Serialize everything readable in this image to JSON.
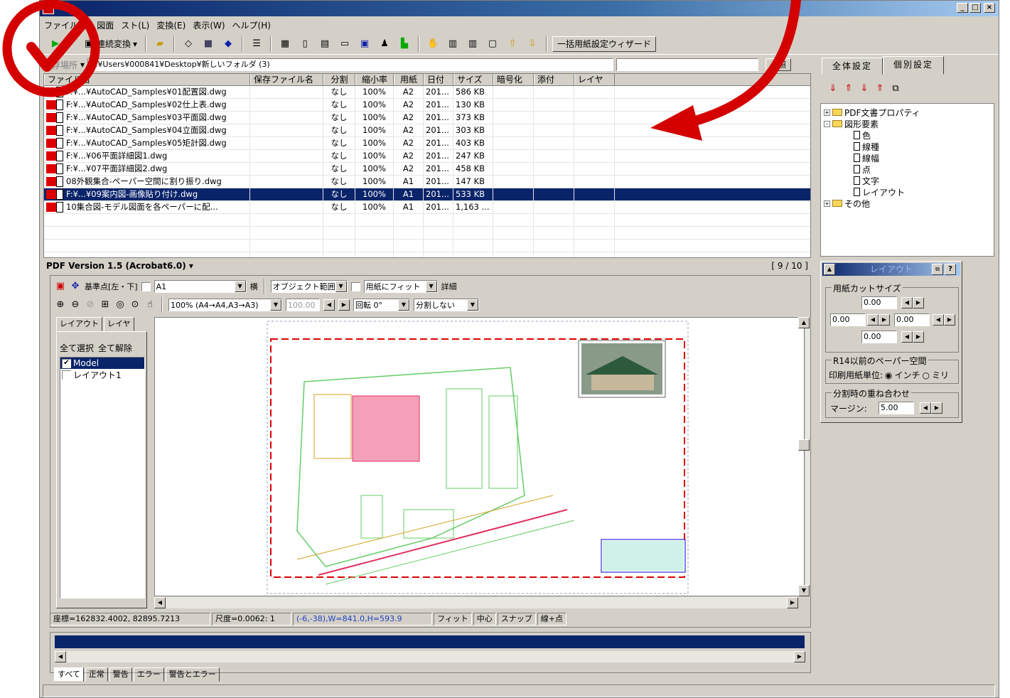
{
  "menu": [
    "ファイル(F)",
    "図面",
    "スト(L)",
    "変換(E)",
    "表示(W)",
    "ヘルプ(H)"
  ],
  "toolbar": {
    "convert_label": "連続変換",
    "wizard_label": "一括用紙設定ウィザード"
  },
  "pathbar": {
    "label": "保存場所",
    "path": "C:¥Users¥000841¥Desktop¥新しいフォルダ (3)",
    "browse": "参照"
  },
  "filelist": {
    "headers": [
      "ファイル名",
      "保存ファイル名",
      "分割",
      "縮小率",
      "用紙",
      "日付",
      "サイズ",
      "暗号化",
      "添付",
      "レイヤ"
    ],
    "rows": [
      {
        "name": "F:¥...¥AutoCAD_Samples¥01配置図.dwg",
        "split": "なし",
        "scale": "100%",
        "paper": "A2",
        "date": "201...",
        "size": "586 KB"
      },
      {
        "name": "F:¥...¥AutoCAD_Samples¥02仕上表.dwg",
        "split": "なし",
        "scale": "100%",
        "paper": "A2",
        "date": "201...",
        "size": "130 KB"
      },
      {
        "name": "F:¥...¥AutoCAD_Samples¥03平面図.dwg",
        "split": "なし",
        "scale": "100%",
        "paper": "A2",
        "date": "201...",
        "size": "373 KB"
      },
      {
        "name": "F:¥...¥AutoCAD_Samples¥04立面図.dwg",
        "split": "なし",
        "scale": "100%",
        "paper": "A2",
        "date": "201...",
        "size": "303 KB"
      },
      {
        "name": "F:¥...¥AutoCAD_Samples¥05矩計図.dwg",
        "split": "なし",
        "scale": "100%",
        "paper": "A2",
        "date": "201...",
        "size": "403 KB"
      },
      {
        "name": "F:¥...¥06平面詳細図1.dwg",
        "split": "なし",
        "scale": "100%",
        "paper": "A2",
        "date": "201...",
        "size": "247 KB"
      },
      {
        "name": "F:¥...¥07平面詳細図2.dwg",
        "split": "なし",
        "scale": "100%",
        "paper": "A2",
        "date": "201...",
        "size": "458 KB"
      },
      {
        "name": "08外観集合-ペーパー空間に割り振り.dwg",
        "split": "なし",
        "scale": "100%",
        "paper": "A1",
        "date": "201...",
        "size": "147 KB"
      },
      {
        "name": "F:¥...¥09案内図-画像貼り付け.dwg",
        "split": "なし",
        "scale": "100%",
        "paper": "A1",
        "date": "201...",
        "size": "533 KB"
      },
      {
        "name": "10集合図-モデル図面を各ペーパーに配...",
        "split": "なし",
        "scale": "100%",
        "paper": "A1",
        "date": "201...",
        "size": "1,163 ..."
      }
    ],
    "selected_row": 8
  },
  "version": {
    "label": "PDF Version 1.5 (Acrobat6.0)",
    "count": "[ 9 / 10 ]"
  },
  "viewer": {
    "base_point": "基準点[左・下]",
    "paper": "A1",
    "orientation": "横",
    "range": "オブジェクト範囲",
    "fit": "用紙にフィット",
    "detail": "詳細",
    "zoom": "100% (A4→A4,A3→A3)",
    "zoom_val": "100.00",
    "rotate": "回転 0°",
    "split": "分割しない",
    "tabs": [
      "レイアウト",
      "レイヤ"
    ],
    "select_all": "全て選択",
    "deselect_all": "全て解除",
    "layouts": [
      "Model",
      "レイアウト1"
    ]
  },
  "status": {
    "coord": "座標=162832.4002, 82895.7213",
    "scale": "尺度=0.0062: 1",
    "box": "(-6,-38),W=841.0,H=593.9",
    "fit": "フィット",
    "center": "中心",
    "snap": "スナップ",
    "snap_mode": "線+点"
  },
  "log_tabs": [
    "すべて",
    "正常",
    "警告",
    "エラー",
    "警告とエラー"
  ],
  "right": {
    "tabs": [
      "全体設定",
      "個別設定"
    ],
    "tree": [
      {
        "label": "PDF文書プロパティ",
        "type": "folder",
        "pm": "+"
      },
      {
        "label": "図形要素",
        "type": "folder",
        "pm": "-"
      },
      {
        "label": "色",
        "type": "doc"
      },
      {
        "label": "線種",
        "type": "doc"
      },
      {
        "label": "線幅",
        "type": "doc"
      },
      {
        "label": "点",
        "type": "doc"
      },
      {
        "label": "文字",
        "type": "doc"
      },
      {
        "label": "レイアウト",
        "type": "doc"
      },
      {
        "label": "その他",
        "type": "folder",
        "pm": "+"
      }
    ],
    "layout_title": "レイアウト",
    "cut_size_label": "用紙カットサイズ",
    "cut_top": "0.00",
    "cut_left": "0.00",
    "cut_right": "0.00",
    "cut_bottom": "0.00",
    "r14_label": "R14以前のペーパー空間",
    "unit_label": "印刷用紙単位:",
    "unit_inch": "インチ",
    "unit_mm": "ミリ",
    "overlap_label": "分割時の重ね合わせ",
    "margin_label": "マージン:",
    "margin_val": "5.00"
  },
  "colors": {
    "selection": "#0a246a",
    "accent_red": "#d40000",
    "face": "#d4d0c8"
  }
}
